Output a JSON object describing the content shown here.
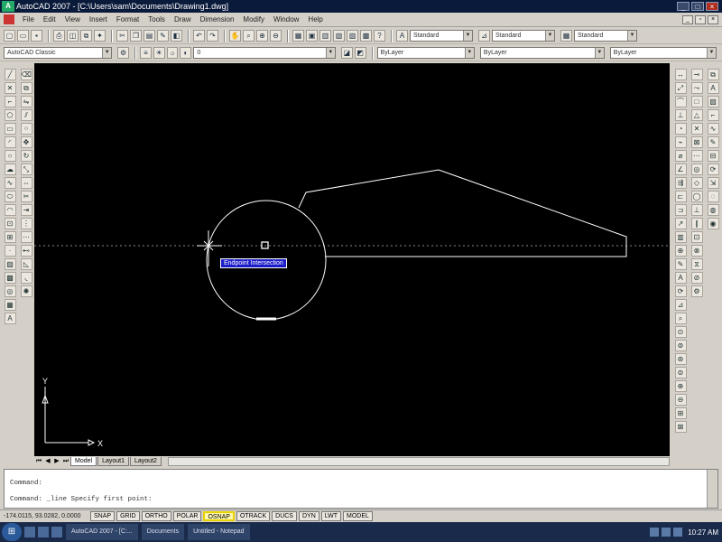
{
  "window": {
    "title": "AutoCAD 2007 - [C:\\Users\\sam\\Documents\\Drawing1.dwg]",
    "app_icon": "autocad-icon"
  },
  "menus": [
    "File",
    "Edit",
    "View",
    "Insert",
    "Format",
    "Tools",
    "Draw",
    "Dimension",
    "Modify",
    "Window",
    "Help"
  ],
  "toolbars": {
    "text_style": "Standard",
    "dim_style": "Standard",
    "table_style": "Standard",
    "workspace": "AutoCAD Classic",
    "color": "ByLayer",
    "linetype": "ByLayer",
    "lineweight": "ByLayer",
    "layer": "0"
  },
  "drawing": {
    "tooltip": "Endpoint Intersection",
    "ucs_x_label": "X",
    "ucs_y_label": "Y",
    "background": "#000000",
    "geometry_color": "#ffffff"
  },
  "layout_tabs": [
    "Model",
    "Layout1",
    "Layout2"
  ],
  "command": {
    "line1": "Command:",
    "line2": "Command: _line Specify first point:"
  },
  "status": {
    "coordinates": "-174.0115, 93.0282, 0.0000",
    "buttons": [
      "SNAP",
      "GRID",
      "ORTHO",
      "POLAR",
      "OSNAP",
      "OTRACK",
      "DUCS",
      "DYN",
      "LWT",
      "MODEL"
    ],
    "active_highlight": "OSNAP"
  },
  "taskbar": {
    "start_icon": "windows-start-icon",
    "tasks": [
      "AutoCAD 2007 - [C:...",
      "Documents",
      "Untitled - Notepad"
    ],
    "clock": "10:27 AM"
  }
}
